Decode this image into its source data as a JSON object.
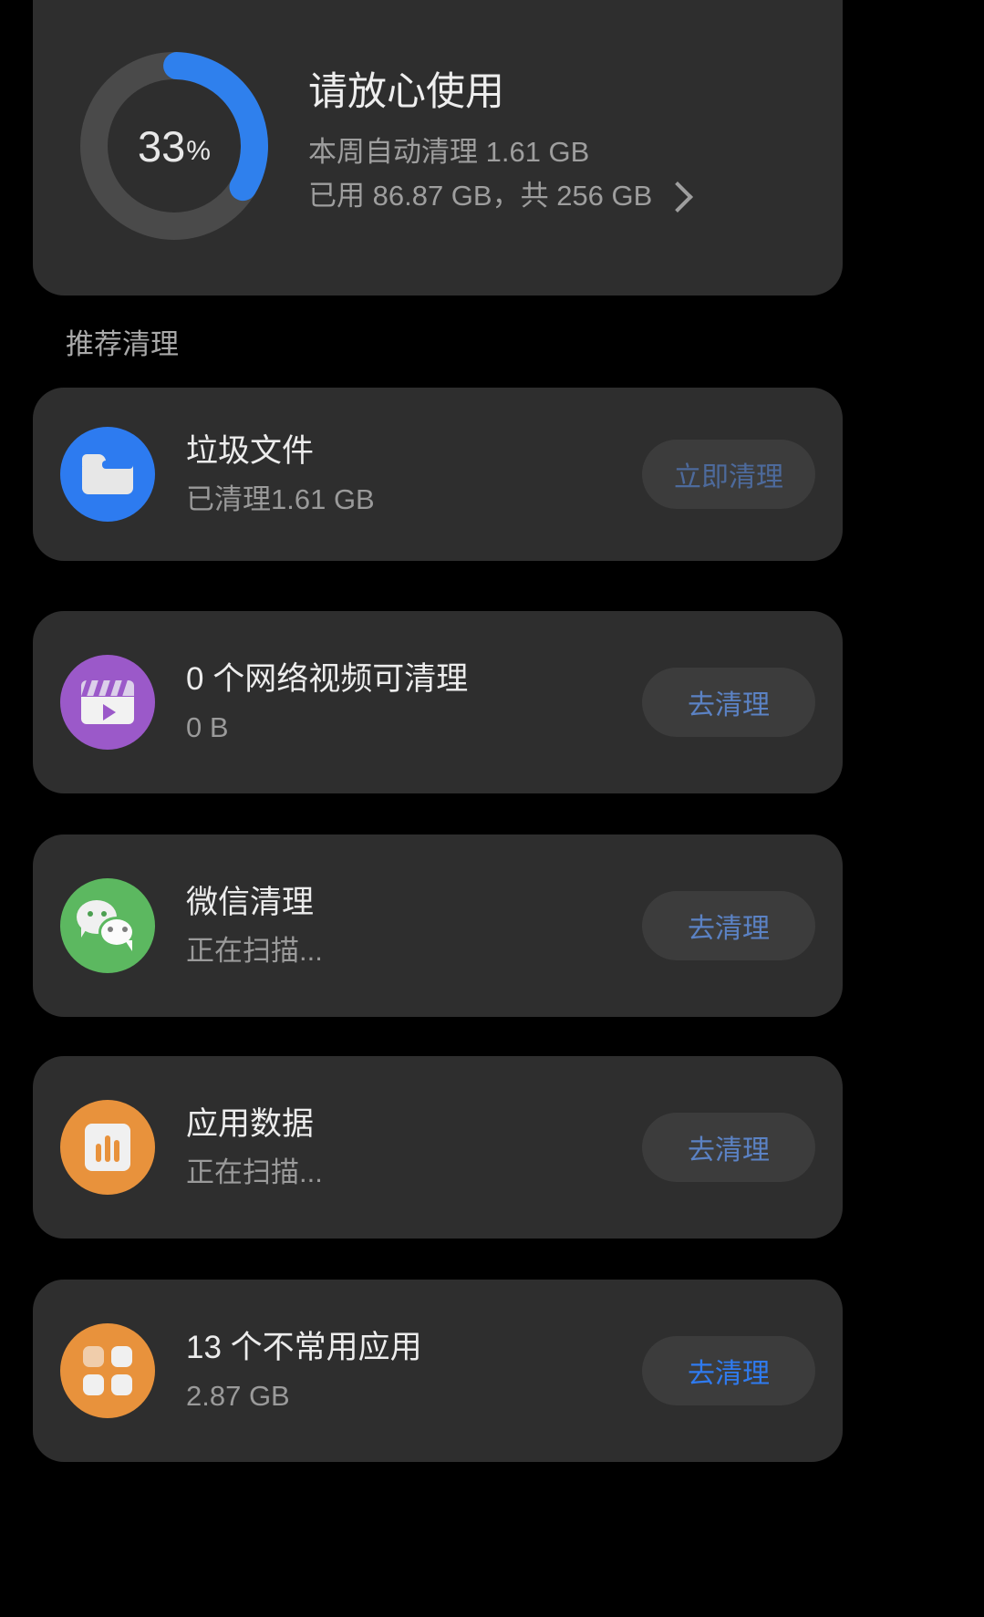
{
  "storage": {
    "percent_number": "33",
    "percent_sign": "%",
    "percent_value": 33,
    "ring_color": "#2f80ed",
    "ring_track_color": "#4a4a4a",
    "title": "请放心使用",
    "line_auto_clean": "本周自动清理 1.61 GB",
    "line_usage": "已用 86.87 GB，共 256 GB",
    "chevron_icon": "chevron-right-icon"
  },
  "section": {
    "header": "推荐清理"
  },
  "items": [
    {
      "icon_name": "folder-icon",
      "icon_bg": "#2d7bf0",
      "title": "垃圾文件",
      "subtitle": "已清理1.61 GB",
      "button_label": "立即清理",
      "button_state": "dim"
    },
    {
      "icon_name": "video-icon",
      "icon_bg": "#9b59c9",
      "title": "0 个网络视频可清理",
      "subtitle": "0 B",
      "button_label": "去清理",
      "button_state": "mid"
    },
    {
      "icon_name": "wechat-icon",
      "icon_bg": "#5cb860",
      "title": "微信清理",
      "subtitle": "正在扫描...",
      "button_label": "去清理",
      "button_state": "mid"
    },
    {
      "icon_name": "app-data-chart-icon",
      "icon_bg": "#e8923c",
      "title": "应用数据",
      "subtitle": "正在扫描...",
      "button_label": "去清理",
      "button_state": "mid"
    },
    {
      "icon_name": "unused-apps-icon",
      "icon_bg": "#e8923c",
      "title": "13 个不常用应用",
      "subtitle": "2.87 GB",
      "button_label": "去清理",
      "button_state": "active"
    }
  ]
}
